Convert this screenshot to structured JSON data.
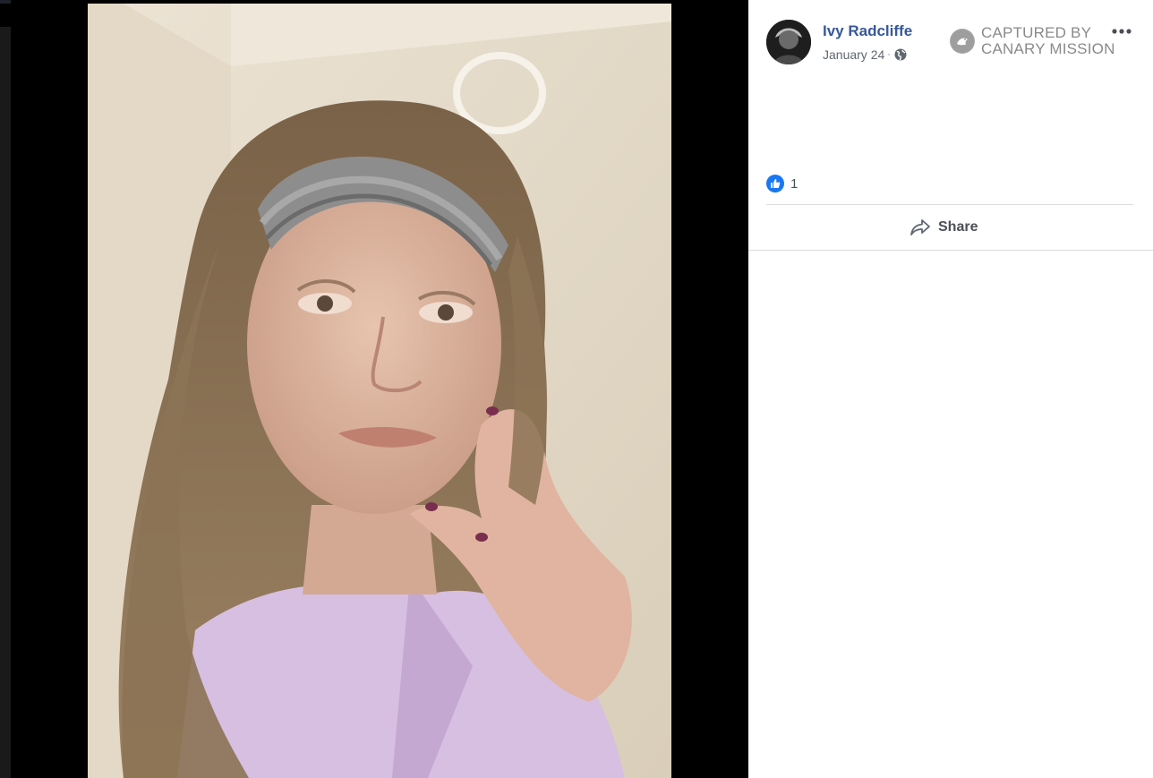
{
  "post": {
    "author_name": "Ivy Radcliffe",
    "date": "January 24",
    "meta_separator": "·",
    "privacy_icon": "globe-icon",
    "more_icon": "more-options-icon",
    "reaction_icon": "like-icon",
    "reaction_count": "1",
    "share_label": "Share",
    "share_icon": "share-arrow-icon"
  },
  "watermark": {
    "line1": "CAPTURED BY",
    "line2": "CANARY MISSION",
    "icon": "canary-bird-logo"
  },
  "colors": {
    "author_link": "#385898",
    "like_blue": "#1877f2",
    "panel_bg": "#ffffff",
    "viewer_bg": "#000000"
  }
}
